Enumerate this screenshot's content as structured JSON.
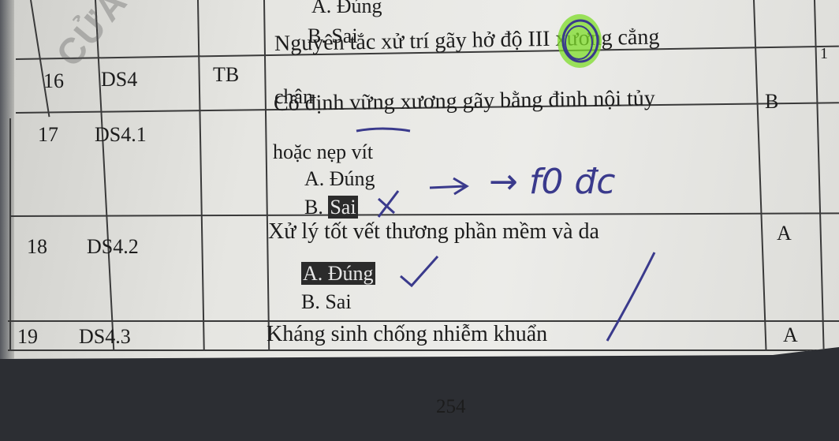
{
  "rows": [
    {
      "num": "16",
      "code": "DS4",
      "level": "TB",
      "question": [
        "Nguyên tắc xử trí gãy hở độ III xương cẳng",
        "chân"
      ],
      "answer": "B"
    },
    {
      "num": "17",
      "code": "DS4.1",
      "level": "",
      "question": [
        "Cố định vững xương gãy bằng đinh nội tủy",
        "hoặc nẹp vít"
      ],
      "options": [
        "A. Đúng",
        "B. Sai"
      ],
      "answer": ""
    },
    {
      "num": "18",
      "code": "DS4.2",
      "level": "",
      "question": [
        "Xử lý tốt vết thương phần mềm và da"
      ],
      "options": [
        "A. Đúng",
        "B. Sai"
      ],
      "answer": "A"
    },
    {
      "num": "19",
      "code": "DS4.3",
      "level": "",
      "question": [
        "Kháng sinh chống nhiễm khuẩn"
      ],
      "answer": "A"
    }
  ],
  "previous_options": [
    "A. Đúng",
    "B. Sai"
  ],
  "page_number": "254",
  "handwriting": {
    "note": "→ f0 đc"
  },
  "margin_mark": "1",
  "colors": {
    "ink": "#3a3a8c",
    "highlighter": "#7ddc2a",
    "paper": "#e6e6e2"
  }
}
